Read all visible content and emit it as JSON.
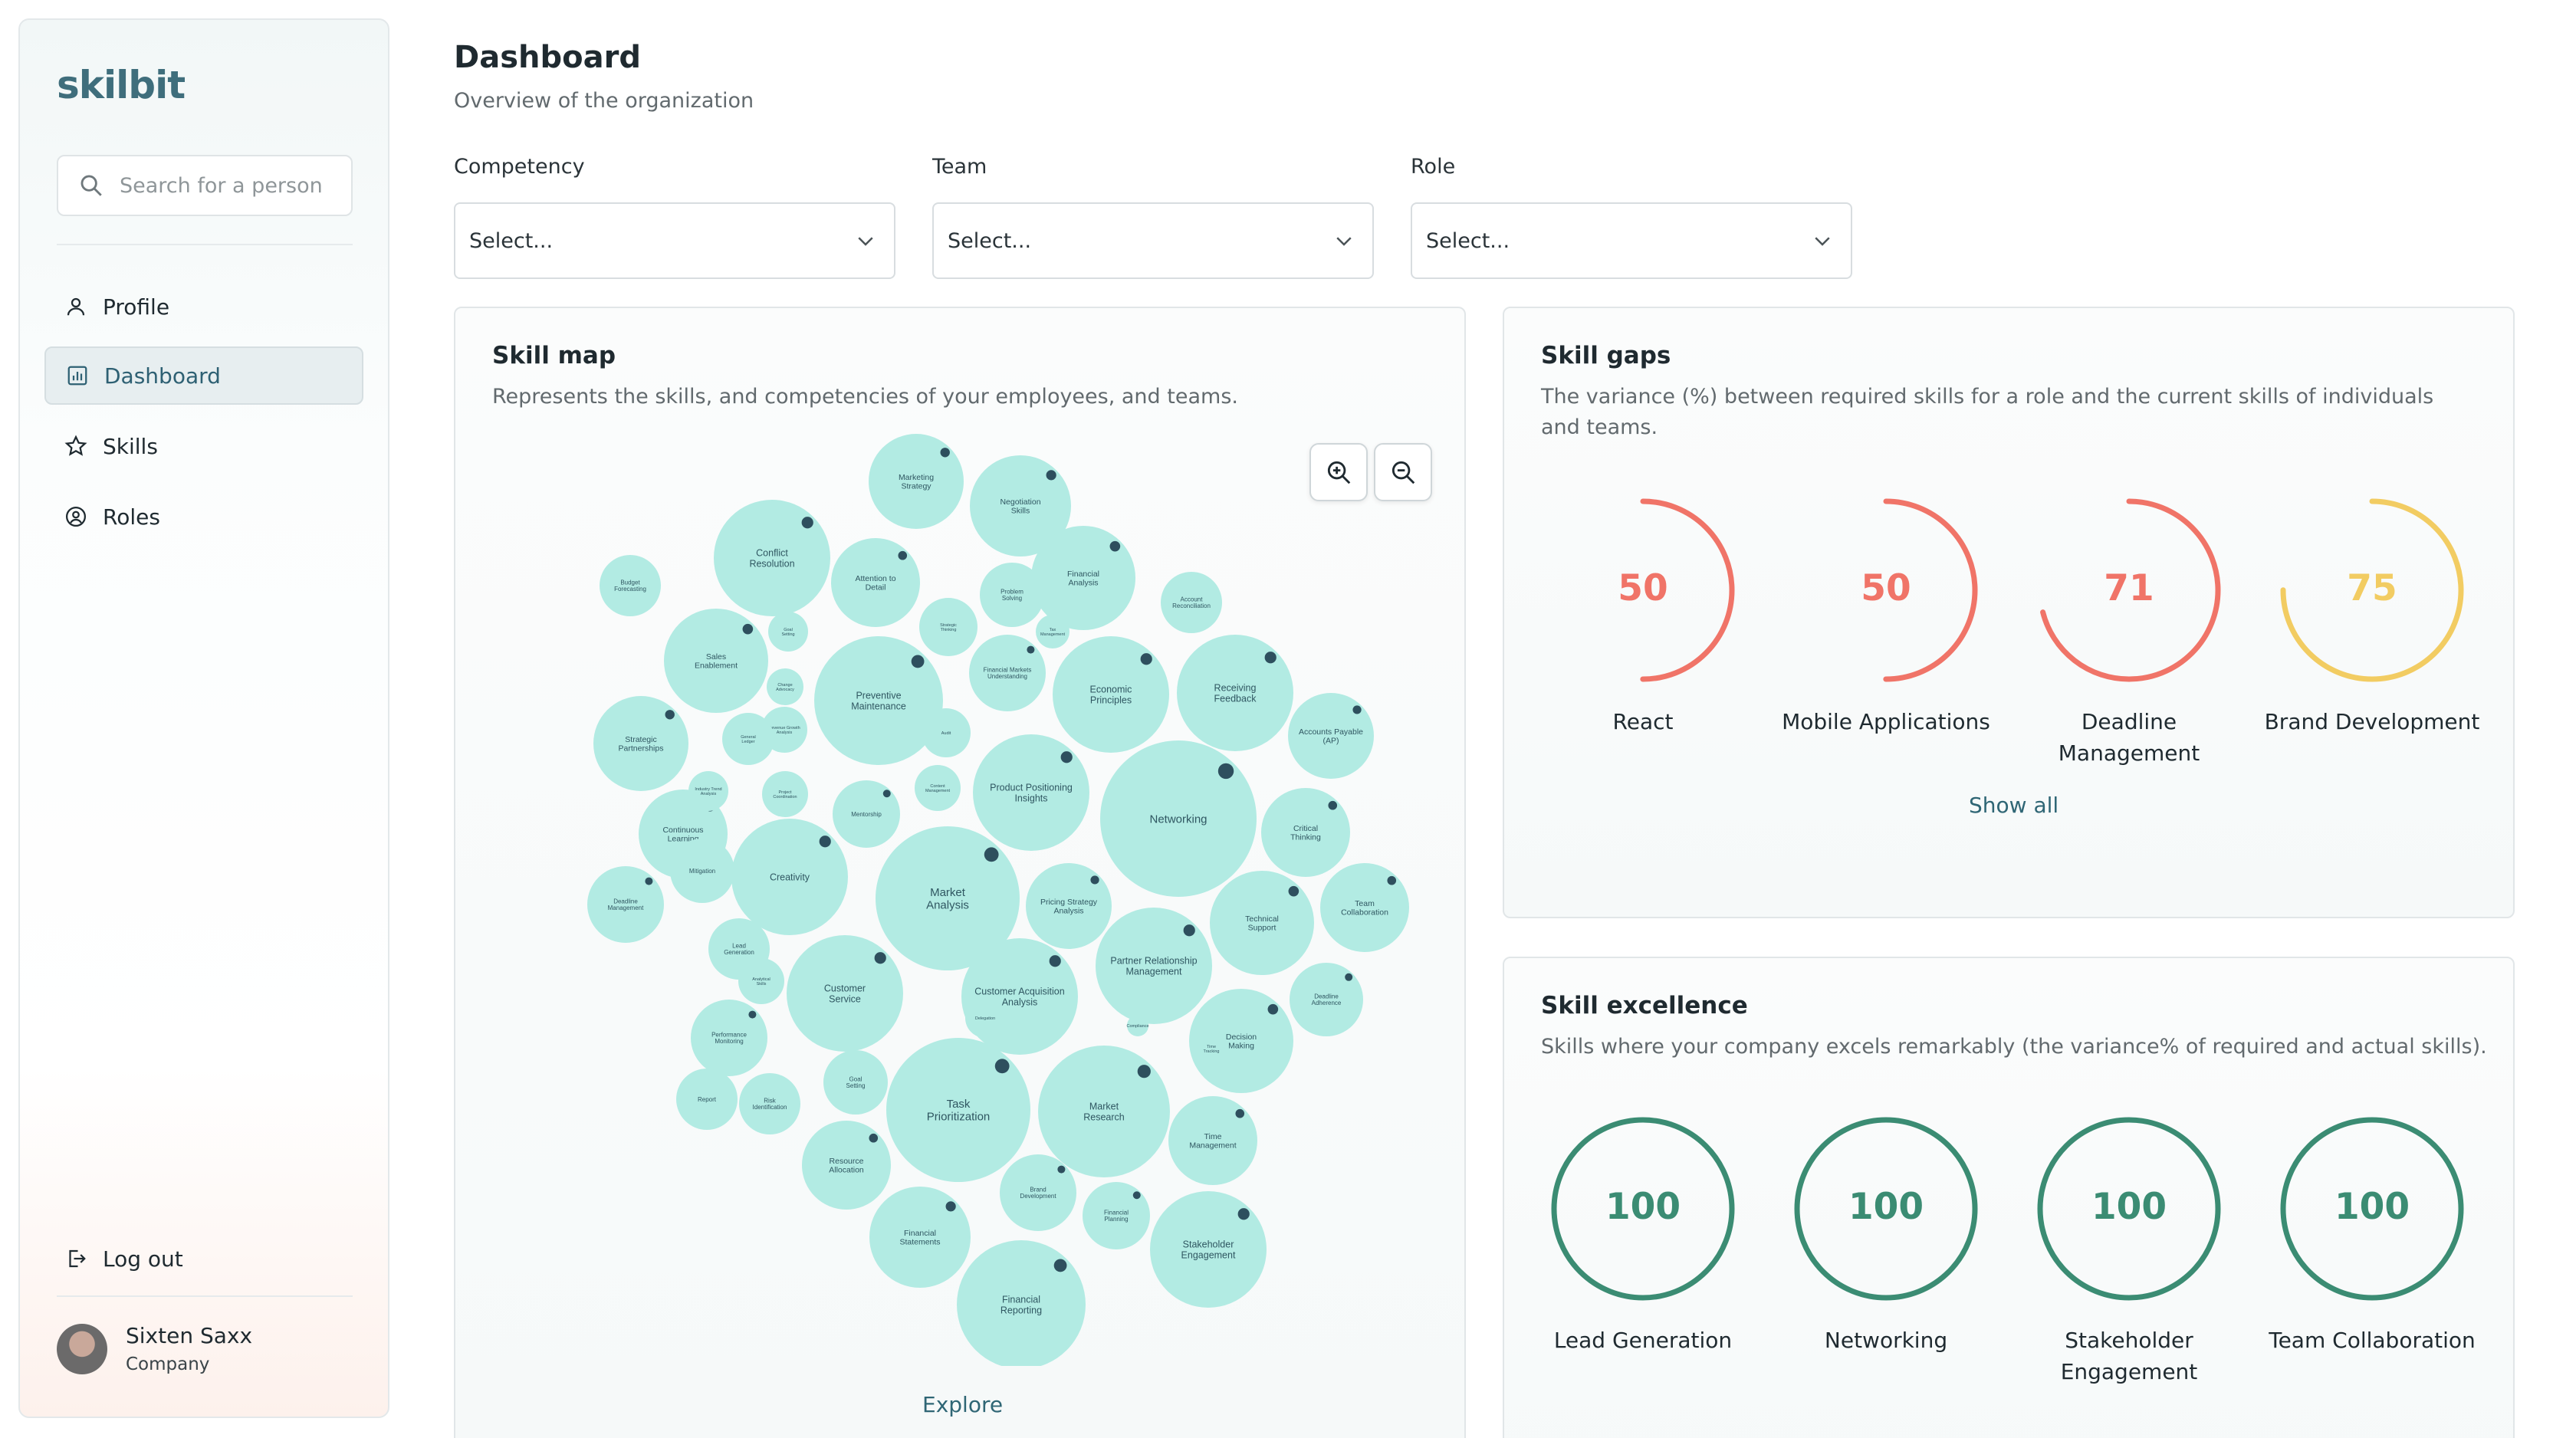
{
  "app": {
    "logo": "skilbit"
  },
  "sidebar": {
    "search_placeholder": "Search for a person",
    "items": [
      {
        "label": "Profile",
        "icon": "user-icon",
        "active": false
      },
      {
        "label": "Dashboard",
        "icon": "bar-chart-icon",
        "active": true
      },
      {
        "label": "Skills",
        "icon": "star-icon",
        "active": false
      },
      {
        "label": "Roles",
        "icon": "user-circle-icon",
        "active": false
      }
    ],
    "logout_label": "Log out",
    "user": {
      "name": "Sixten Saxx",
      "company": "Company"
    }
  },
  "header": {
    "title": "Dashboard",
    "subtitle": "Overview of the organization"
  },
  "filters": [
    {
      "label": "Competency",
      "value": "Select..."
    },
    {
      "label": "Team",
      "value": "Select..."
    },
    {
      "label": "Role",
      "value": "Select..."
    }
  ],
  "skill_map": {
    "title": "Skill map",
    "description": "Represents the skills, and competencies of your employees, and teams.",
    "explore_label": "Explore",
    "bubble_color": "#b2ebe3",
    "skills": [
      "Marketing Strategy",
      "Negotiation Skills",
      "Conflict Resolution",
      "Attention to Detail",
      "Financial Analysis",
      "Sales Enablement",
      "Preventive Maintenance",
      "Economic Principles",
      "Receiving Feedback",
      "Strategic Partnerships",
      "Accounts Payable (AP)",
      "Product Positioning Insights",
      "Networking",
      "Continuous Learning",
      "Creativity",
      "Critical Thinking",
      "Market Analysis",
      "Pricing Strategy Analysis",
      "Technical Support",
      "Team Collaboration",
      "Deadline Management",
      "Customer Service",
      "Partner Relationship Management",
      "Customer Acquisition Analysis",
      "Deadline Adherence",
      "Decision Making",
      "Performance Monitoring",
      "Task Prioritization",
      "Market Research",
      "Time Management",
      "Resource Allocation",
      "Financial Statements",
      "Stakeholder Engagement",
      "Financial Reporting",
      "Mentorship",
      "Problem Solving",
      "Strategic Thinking",
      "Financial Markets Understanding",
      "Account Reconciliation",
      "Budget Forecasting",
      "Goal Setting",
      "Change Advocacy",
      "Revenue Growth Analysis",
      "Project Coordination",
      "Content Management",
      "General Ledger",
      "Industry Trend Analysis",
      "Mitigation",
      "Lead Generation",
      "Analytical Skills",
      "Risk Identification",
      "Brand Development",
      "Financial Planning",
      "Report",
      "Goal Setting",
      "Tax Management",
      "Audit",
      "Compliance",
      "Time Tracking",
      "Delegation"
    ]
  },
  "skill_gaps": {
    "title": "Skill gaps",
    "description": "The variance (%) between required skills for a role and the current skills of individuals and teams.",
    "show_all_label": "Show all",
    "items": [
      {
        "label": "React",
        "value": 50,
        "color": "#f07468"
      },
      {
        "label": "Mobile Applications",
        "value": 50,
        "color": "#f07468"
      },
      {
        "label": "Deadline Management",
        "value": 71,
        "color": "#f07468"
      },
      {
        "label": "Brand Development",
        "value": 75,
        "color": "#f2cc62"
      }
    ]
  },
  "skill_excellence": {
    "title": "Skill excellence",
    "description": "Skills where your company excels remarkably (the variance% of required and actual skills).",
    "items": [
      {
        "label": "Lead Generation",
        "value": 100,
        "color": "#3b8c73"
      },
      {
        "label": "Networking",
        "value": 100,
        "color": "#3b8c73"
      },
      {
        "label": "Stakeholder Engagement",
        "value": 100,
        "color": "#3b8c73"
      },
      {
        "label": "Team Collaboration",
        "value": 100,
        "color": "#3b8c73"
      }
    ]
  }
}
